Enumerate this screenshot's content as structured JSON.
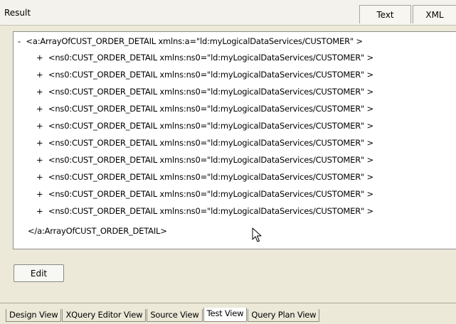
{
  "header": {
    "title": "Result",
    "text_button": "Text",
    "xml_button": "XML"
  },
  "tree": {
    "root": {
      "expander": "-",
      "label": "<a:ArrayOfCUST_ORDER_DETAIL xmlns:a=\"ld:myLogicalDataServices/CUSTOMER\" >"
    },
    "children": [
      {
        "expander": "+",
        "label": "<ns0:CUST_ORDER_DETAIL xmlns:ns0=\"ld:myLogicalDataServices/CUSTOMER\" >"
      },
      {
        "expander": "+",
        "label": "<ns0:CUST_ORDER_DETAIL xmlns:ns0=\"ld:myLogicalDataServices/CUSTOMER\" >"
      },
      {
        "expander": "+",
        "label": "<ns0:CUST_ORDER_DETAIL xmlns:ns0=\"ld:myLogicalDataServices/CUSTOMER\" >"
      },
      {
        "expander": "+",
        "label": "<ns0:CUST_ORDER_DETAIL xmlns:ns0=\"ld:myLogicalDataServices/CUSTOMER\" >"
      },
      {
        "expander": "+",
        "label": "<ns0:CUST_ORDER_DETAIL xmlns:ns0=\"ld:myLogicalDataServices/CUSTOMER\" >"
      },
      {
        "expander": "+",
        "label": "<ns0:CUST_ORDER_DETAIL xmlns:ns0=\"ld:myLogicalDataServices/CUSTOMER\" >"
      },
      {
        "expander": "+",
        "label": "<ns0:CUST_ORDER_DETAIL xmlns:ns0=\"ld:myLogicalDataServices/CUSTOMER\" >"
      },
      {
        "expander": "+",
        "label": "<ns0:CUST_ORDER_DETAIL xmlns:ns0=\"ld:myLogicalDataServices/CUSTOMER\" >"
      },
      {
        "expander": "+",
        "label": "<ns0:CUST_ORDER_DETAIL xmlns:ns0=\"ld:myLogicalDataServices/CUSTOMER\" >"
      },
      {
        "expander": "+",
        "label": "<ns0:CUST_ORDER_DETAIL xmlns:ns0=\"ld:myLogicalDataServices/CUSTOMER\" >"
      }
    ],
    "closing": "</a:ArrayOfCUST_ORDER_DETAIL>"
  },
  "edit_button": "Edit",
  "bottom_tabs": [
    {
      "label": "Design View",
      "active": false
    },
    {
      "label": "XQuery Editor View",
      "active": false
    },
    {
      "label": "Source View",
      "active": false
    },
    {
      "label": "Test View",
      "active": true
    },
    {
      "label": "Query Plan View",
      "active": false
    }
  ],
  "icons": {
    "cursor": "mouse-pointer-icon"
  }
}
